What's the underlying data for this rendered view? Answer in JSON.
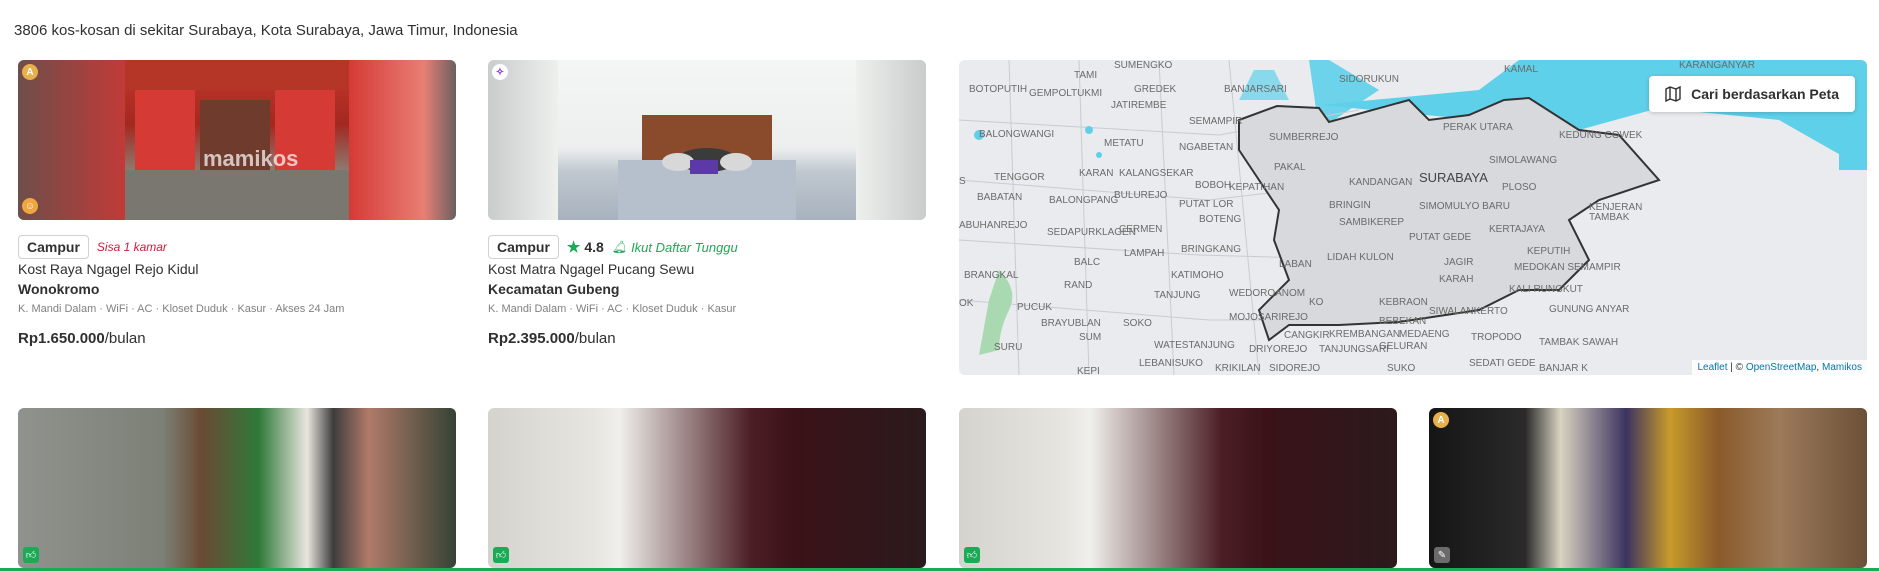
{
  "results": {
    "count_text": "3806 kos-kosan di sekitar Surabaya, Kota Surabaya, Jawa Timur, Indonesia"
  },
  "listings": [
    {
      "type": "Campur",
      "remaining": "Sisa 1 kamar",
      "name": "Kost Raya Ngagel Rejo Kidul",
      "area": "Wonokromo",
      "facilities": "K. Mandi Dalam · WiFi · AC · Kloset Duduk · Kasur · Akses 24 Jam",
      "price": "Rp1.650.000",
      "period": "/bulan",
      "watermark": "mamikos"
    },
    {
      "type": "Campur",
      "rating": "4.8",
      "waitlist": "Ikut Daftar Tunggu",
      "name": "Kost Matra Ngagel Pucang Sewu",
      "area": "Kecamatan Gubeng",
      "facilities": "K. Mandi Dalam · WiFi · AC · Kloset Duduk · Kasur",
      "price": "Rp2.395.000",
      "period": "/bulan"
    }
  ],
  "map": {
    "search_button": "Cari berdasarkan Peta",
    "attribution_leaflet": "Leaflet",
    "attribution_sep": "| ©",
    "attribution_osm": "OpenStreetMap",
    "attribution_mamikos": "Mamikos",
    "labels": {
      "surabaya": "SURABAYA",
      "sumengko": "SUMENGKO",
      "tami": "TAMI",
      "gredek": "GREDEK",
      "banjarsari": "BANJARSARI",
      "sidorukun": "SIDORUKUN",
      "kamal": "KAMAL",
      "karanganyar": "KARANGANYAR",
      "botoputih": "BOTOPUTIH",
      "gempoltukmi": "GEMPOLTUKMI",
      "jatirembe": "JATIREMBE",
      "semampir": "SEMAMPIR",
      "sumberrejo": "SUMBERREJO",
      "perak_utara": "PERAK UTARA",
      "kedung_cowek": "KEDUNG COWEK",
      "balongwangi": "BALONGWANGI",
      "metatu": "METATU",
      "ngabetan": "NGABETAN",
      "pakal": "PAKAL",
      "kandangan": "KANDANGAN",
      "simolawang": "SIMOLAWANG",
      "tenggor": "TENGGOR",
      "karangsekar": "KALANGSEKAR",
      "bobor": "BOBOH",
      "kepatihan": "KEPATIHAN",
      "plosos": "PLOSO",
      "babatan": "BABATAN",
      "balongpanggang": "BALONGPANG",
      "bulurejo": "BULUREJO",
      "putat_lor": "PUTAT LOR",
      "bringin": "BRINGIN",
      "simomulyo": "SIMOMULYO BARU",
      "kenjeran": "KENJERAN",
      "abuhanrejo": "ABUHANREJO",
      "sedapurklagen": "SEDAPURKLAGEN",
      "cermen": "CERMEN",
      "boteng": "BOTENG",
      "sambikerep": "SAMBIKEREP",
      "putat_gede": "PUTAT GEDE",
      "kertajaya": "KERTAJAYA",
      "tambak": "TAMBAK",
      "brangkal": "BRANGKAL",
      "balongbendo": "BALC",
      "lampah": "LAMPAH",
      "bringkang": "BRINGKANG",
      "laban": "LABAN",
      "lidah_kulon": "LIDAH KULON",
      "jagir": "JAGIR",
      "keputih": "KEPUTIH",
      "medokan": "MEDOKAN SEMAMPIR",
      "katimoho": "KATIMOHO",
      "karah": "KARAH",
      "rand": "RAND",
      "tanjung": "TANJUNG",
      "wedoroanom": "WEDOROANOM",
      "kebraon": "KEBRAON",
      "kali_rungkut": "KALI RUNGKUT",
      "pucuk": "PUCUK",
      "mojosarirejo": "MOJOSARIREJO",
      "behaban": "BEBEKAN",
      "siwalankerto": "SIWALANKERTO",
      "gunung_anyar": "GUNUNG ANYAR",
      "brayublan": "BRAYUBLAN",
      "soko": "SOKO",
      "cangkir": "CANGKIR",
      "krembangan": "KREMBANGAN",
      "medaeng": "MEDAENG",
      "tropodo": "TROPODO",
      "tambak_sawah": "TAMBAK SAWAH",
      "suru": "SURU",
      "watestanjung": "WATESTANJUNG",
      "driyorejo": "DRIYOREJO",
      "tanjungsari": "TANJUNGSARI",
      "geluran": "GELURAN",
      "lebanisuko": "LEBANISUKO",
      "krikilan": "KRIKILAN",
      "sidorejo": "SIDOREJO",
      "suko": "SUKO",
      "sedati_gede": "SEDATI GEDE",
      "banjar_kemuning": "BANJAR K",
      "ko": "KO",
      "ok": "OK",
      "s": "S",
      "kepi": "KEPI",
      "sum": "SUM",
      "karan": "KARAN"
    }
  },
  "colors": {
    "accent_green": "#1baa56",
    "danger_red": "#d0193a",
    "water": "#5fd0ea",
    "map_land": "#e9ebee"
  }
}
